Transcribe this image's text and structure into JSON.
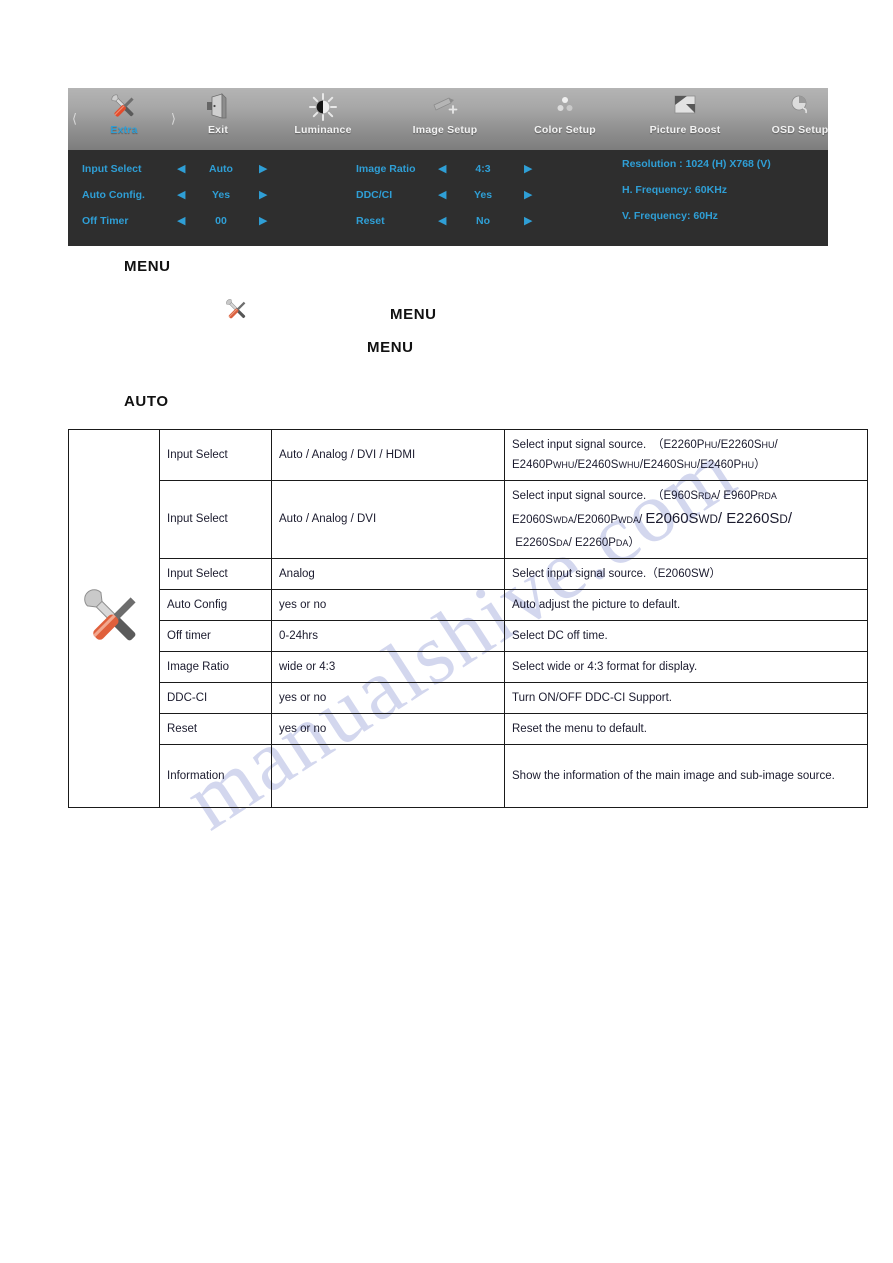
{
  "osd": {
    "tabs": [
      {
        "label": "Extra",
        "icon": "tools-icon",
        "selected": true
      },
      {
        "label": "Exit",
        "icon": "exit-door-icon",
        "selected": false
      },
      {
        "label": "Luminance",
        "icon": "brightness-icon",
        "selected": false
      },
      {
        "label": "Image Setup",
        "icon": "image-setup-icon",
        "selected": false
      },
      {
        "label": "Color Setup",
        "icon": "color-dots-icon",
        "selected": false
      },
      {
        "label": "Picture Boost",
        "icon": "picture-boost-icon",
        "selected": false
      },
      {
        "label": "OSD Setup",
        "icon": "osd-setup-icon",
        "selected": false
      }
    ],
    "nav_left_icon": "chevron-left-icon",
    "nav_right_icon": "chevron-right-icon",
    "column1": [
      {
        "label": "Input Select",
        "value": "Auto"
      },
      {
        "label": "Auto Config.",
        "value": "Yes"
      },
      {
        "label": "Off Timer",
        "value": "00"
      }
    ],
    "column2": [
      {
        "label": "Image Ratio",
        "value": "4:3"
      },
      {
        "label": "DDC/CI",
        "value": "Yes"
      },
      {
        "label": "Reset",
        "value": "No"
      }
    ],
    "info": [
      "Resolution : 1024 (H) X768 (V)",
      "H. Frequency: 60KHz",
      "V. Frequency: 60Hz"
    ],
    "arrow_left": "◀",
    "arrow_right": "▶",
    "accent_color": "#2f9fd6",
    "panel_color": "#2e2e2e"
  },
  "doc_words": [
    {
      "text": "MENU"
    },
    {
      "text": "MENU"
    },
    {
      "text": "MENU"
    },
    {
      "text": "AUTO"
    }
  ],
  "table": {
    "icon_cell": "tools-icon",
    "rows": [
      {
        "function": "Input Select",
        "value": "Auto / Analog / DVI / HDMI",
        "desc_line1": "Select   input   signal   source.　（E2260P",
        "desc_line1_sub": "HU",
        "desc_line1_b": "/E2260S",
        "desc_line1_sub2": "HU",
        "desc_line1_c": "/"
      },
      {
        "function": "Input Select",
        "value": "Auto / Analog / DVI"
      },
      {
        "function": "Input Select",
        "value": "Analog",
        "desc": "Select input signal source.（E2060SW）"
      },
      {
        "function": "Auto Config",
        "value": "yes or no",
        "desc": "Auto adjust the picture to default."
      },
      {
        "function": "Off timer",
        "value": "0-24hrs",
        "desc": "Select DC off time."
      },
      {
        "function": "Image Ratio",
        "value": "wide or 4:3",
        "desc": "Select wide or 4:3 format for display."
      },
      {
        "function": "DDC-CI",
        "value": "yes or no",
        "desc": "Turn ON/OFF DDC-CI Support."
      },
      {
        "function": "Reset",
        "value": "yes or no",
        "desc": "Reset the menu to default."
      },
      {
        "function": "Information",
        "value": "",
        "desc": "Show the information of the main image and sub-image source."
      }
    ],
    "desc_row1_prefix": "Select   input   signal   source.　（",
    "desc_row1_models": "E2260PHU/E2260SHU/ E2460PWHU/E2460SWHU/E2460SHU/E2460PHU）",
    "desc_row2_prefix": "Select input signal source.　（",
    "desc_row2_models": "E960SRDA/ E960PRDA E2060SWDA/E2060PWDA/ E2060SWD/ E2260SD/ E2260SDA/ E2260PDA）"
  },
  "watermark": {
    "text": "manualshive.com",
    "color": "#b9bfe4"
  }
}
